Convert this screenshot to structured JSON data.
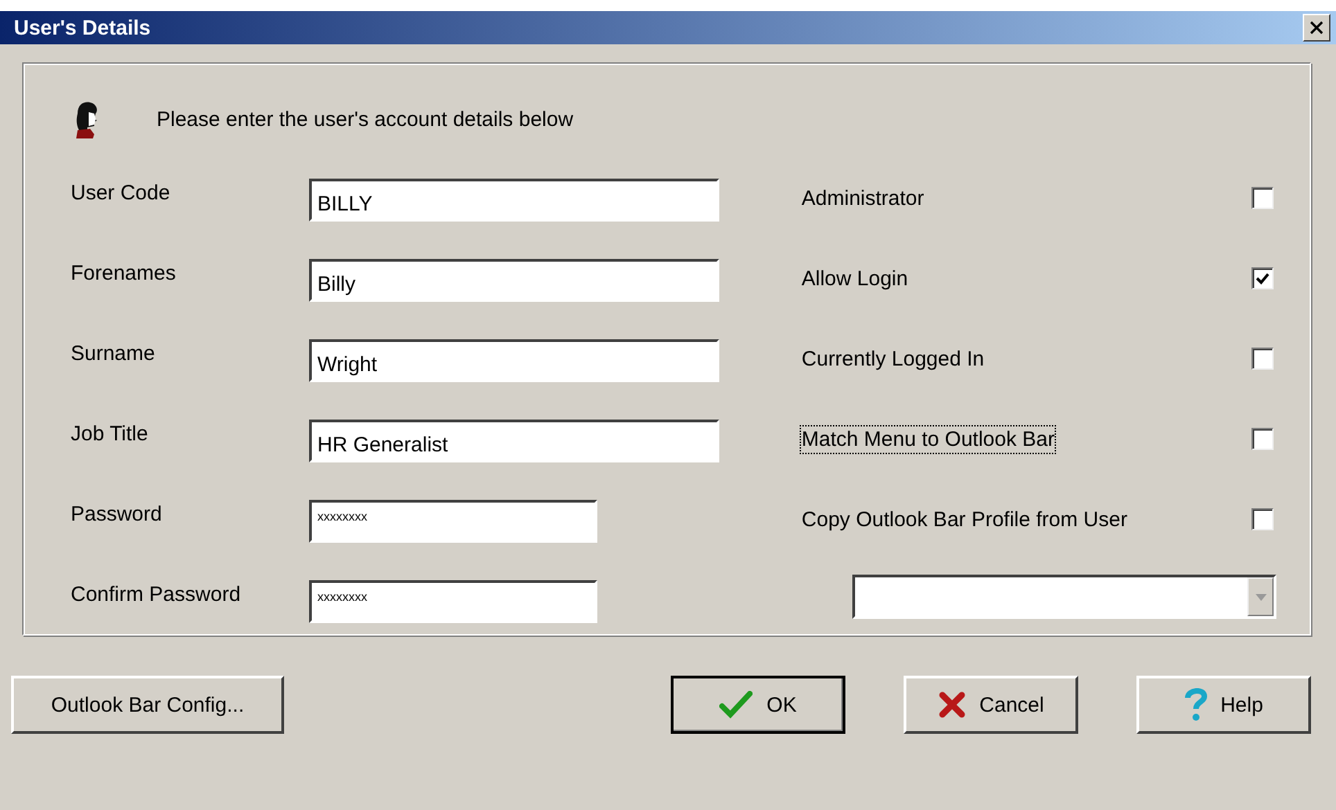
{
  "window": {
    "title": "User's Details"
  },
  "header": {
    "message": "Please enter the user's account details below"
  },
  "fields": [
    {
      "label": "User Code",
      "value": "BILLY",
      "kind": "text"
    },
    {
      "label": "Forenames",
      "value": "Billy",
      "kind": "text"
    },
    {
      "label": "Surname",
      "value": "Wright",
      "kind": "text"
    },
    {
      "label": "Job Title",
      "value": "HR Generalist",
      "kind": "text"
    },
    {
      "label": "Password",
      "value": "xxxxxxxx",
      "kind": "password"
    },
    {
      "label": "Confirm Password",
      "value": "xxxxxxxx",
      "kind": "password"
    }
  ],
  "options": [
    {
      "label": "Administrator",
      "checked": false,
      "focused": false
    },
    {
      "label": "Allow Login",
      "checked": true,
      "focused": false
    },
    {
      "label": "Currently Logged In",
      "checked": false,
      "focused": false
    },
    {
      "label": "Match Menu to Outlook Bar",
      "checked": false,
      "focused": true
    },
    {
      "label": "Copy Outlook Bar Profile from User",
      "checked": false,
      "focused": false
    }
  ],
  "buttons": [
    {
      "label": "Outlook Bar Config...",
      "kind": "plain"
    },
    {
      "label": "OK",
      "kind": "ok"
    },
    {
      "label": "Cancel",
      "kind": "cancel"
    },
    {
      "label": "Help",
      "kind": "help"
    }
  ]
}
